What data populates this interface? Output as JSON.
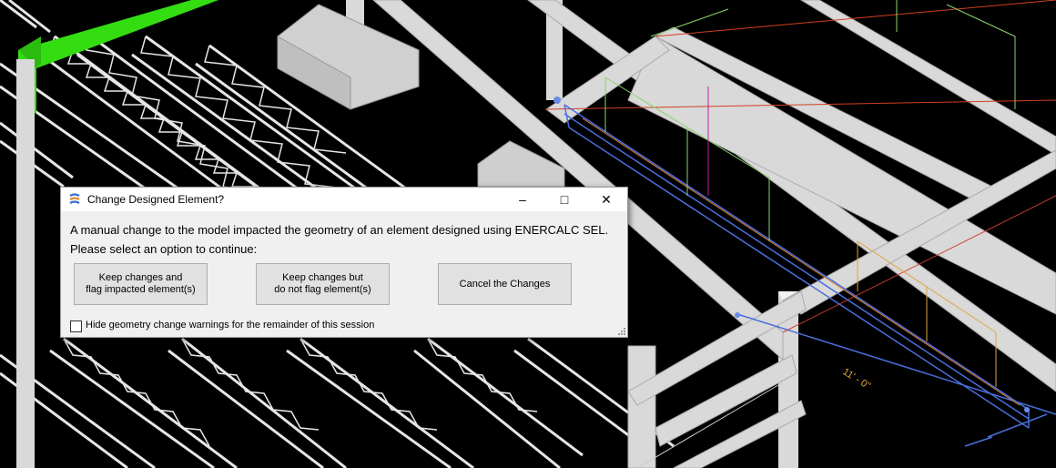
{
  "viewport": {
    "dimension_label": "11' - 0\""
  },
  "dialog": {
    "title": "Change Designed Element?",
    "icon": "enercalc-logo-icon",
    "window_controls": {
      "minimize": "–",
      "maximize": "□",
      "close": "✕"
    },
    "message_line1": "A manual change to the model impacted the geometry of an element designed using ENERCALC SEL.",
    "message_line2": "Please select an option to continue:",
    "buttons": {
      "keep_flag": "Keep changes and\nflag impacted element(s)",
      "keep_noflag": "Keep changes but\ndo not flag element(s)",
      "cancel": "Cancel the Changes"
    },
    "checkbox": {
      "label": "Hide geometry change warnings for the remainder of this session",
      "checked": false
    }
  },
  "colors": {
    "viewport_bg": "#000000",
    "steel": "#d9d9d9",
    "highlight_member": "#33dd11",
    "selection": "#4a6fdc",
    "load_green": "#8bd46a",
    "load_orange": "#e0a43a",
    "dialog_bg": "#f0f0f0"
  }
}
